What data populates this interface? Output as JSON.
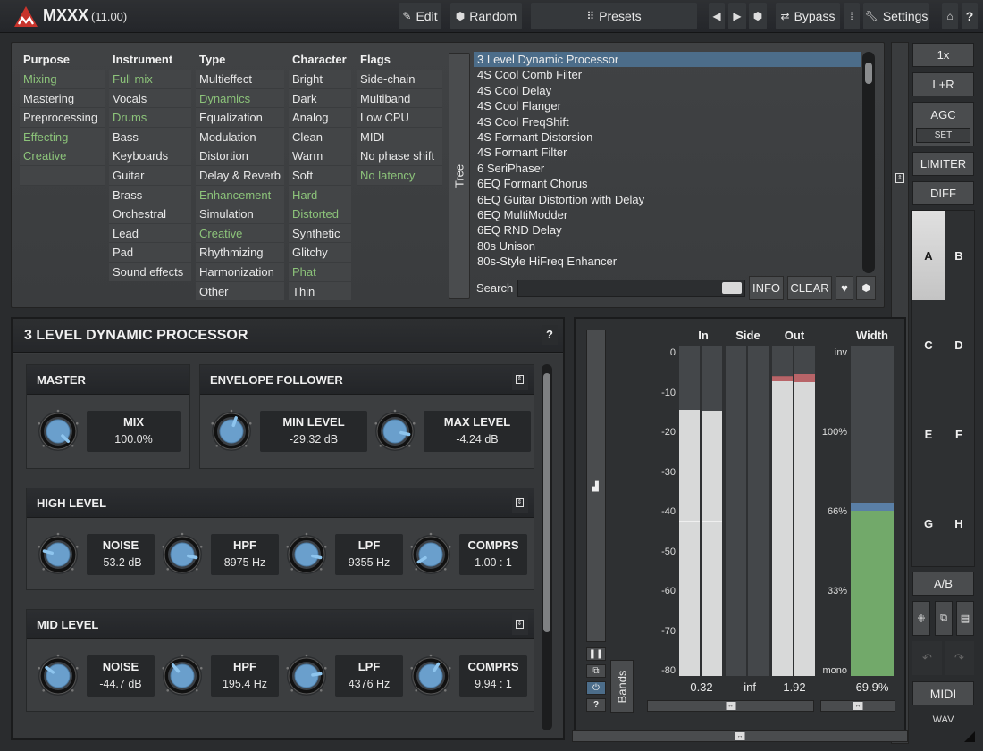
{
  "app": {
    "title": "MXXX",
    "version": "(11.00)"
  },
  "toolbar": {
    "edit": "Edit",
    "random": "Random",
    "presets": "Presets",
    "bypass": "Bypass",
    "settings": "Settings",
    "help": "?"
  },
  "browser": {
    "columns": [
      {
        "header": "Purpose",
        "items": [
          {
            "label": "Mixing",
            "selected": true
          },
          {
            "label": "Mastering",
            "selected": false
          },
          {
            "label": "Preprocessing",
            "selected": false
          },
          {
            "label": "Effecting",
            "selected": true
          },
          {
            "label": "Creative",
            "selected": true
          },
          {
            "label": "",
            "selected": false
          }
        ]
      },
      {
        "header": "Instrument",
        "items": [
          {
            "label": "Full mix",
            "selected": true
          },
          {
            "label": "Vocals",
            "selected": false
          },
          {
            "label": "Drums",
            "selected": true
          },
          {
            "label": "Bass",
            "selected": false
          },
          {
            "label": "Keyboards",
            "selected": false
          },
          {
            "label": "Guitar",
            "selected": false
          },
          {
            "label": "Brass",
            "selected": false
          },
          {
            "label": "Orchestral",
            "selected": false
          },
          {
            "label": "Lead",
            "selected": false
          },
          {
            "label": "Pad",
            "selected": false
          },
          {
            "label": "Sound effects",
            "selected": false
          }
        ]
      },
      {
        "header": "Type",
        "items": [
          {
            "label": "Multieffect",
            "selected": false
          },
          {
            "label": "Dynamics",
            "selected": true
          },
          {
            "label": "Equalization",
            "selected": false
          },
          {
            "label": "Modulation",
            "selected": false
          },
          {
            "label": "Distortion",
            "selected": false
          },
          {
            "label": "Delay & Reverb",
            "selected": false
          },
          {
            "label": "Enhancement",
            "selected": true
          },
          {
            "label": "Simulation",
            "selected": false
          },
          {
            "label": "Creative",
            "selected": true
          },
          {
            "label": "Rhythmizing",
            "selected": false
          },
          {
            "label": "Harmonization",
            "selected": false
          },
          {
            "label": "Other",
            "selected": false
          }
        ]
      },
      {
        "header": "Character",
        "items": [
          {
            "label": "Bright",
            "selected": false
          },
          {
            "label": "Dark",
            "selected": false
          },
          {
            "label": "Analog",
            "selected": false
          },
          {
            "label": "Clean",
            "selected": false
          },
          {
            "label": "Warm",
            "selected": false
          },
          {
            "label": "Soft",
            "selected": false
          },
          {
            "label": "Hard",
            "selected": true
          },
          {
            "label": "Distorted",
            "selected": true
          },
          {
            "label": "Synthetic",
            "selected": false
          },
          {
            "label": "Glitchy",
            "selected": false
          },
          {
            "label": "Phat",
            "selected": true
          },
          {
            "label": "Thin",
            "selected": false
          }
        ]
      },
      {
        "header": "Flags",
        "items": [
          {
            "label": "Side-chain",
            "selected": false
          },
          {
            "label": "Multiband",
            "selected": false
          },
          {
            "label": "Low CPU",
            "selected": false
          },
          {
            "label": "MIDI",
            "selected": false
          },
          {
            "label": "No phase shift",
            "selected": false
          },
          {
            "label": "No latency",
            "selected": true
          }
        ]
      }
    ],
    "tree_label": "Tree",
    "presets": [
      "3 Level Dynamic Processor",
      "4S Cool Comb Filter",
      "4S Cool Delay",
      "4S Cool Flanger",
      "4S Cool FreqShift",
      "4S Formant Distorsion",
      "4S Formant Filter",
      "6 SeriPhaser",
      "6EQ Formant Chorus",
      "6EQ Guitar Distortion with Delay",
      "6EQ MultiModder",
      "6EQ RND Delay",
      "80s Unison",
      "80s-Style HiFreq Enhancer"
    ],
    "selected_preset_index": 0,
    "search_label": "Search",
    "search_value": "",
    "info": "INFO",
    "clear": "CLEAR"
  },
  "right_panel": {
    "oversampling": "1x",
    "channel": "L+R",
    "agc": "AGC",
    "agc_set": "SET",
    "limiter": "LIMITER",
    "diff": "DIFF",
    "slots": [
      "A",
      "B",
      "C",
      "D",
      "E",
      "F",
      "G",
      "H"
    ],
    "active_slot": "A",
    "ab": "A/B",
    "midi": "MIDI",
    "wav": "WAV"
  },
  "editor": {
    "title": "3 LEVEL DYNAMIC PROCESSOR",
    "help": "?",
    "groups": {
      "master": {
        "title": "MASTER",
        "params": [
          {
            "name": "MIX",
            "value": "100.0%",
            "norm": 1.0
          }
        ]
      },
      "envelope": {
        "title": "ENVELOPE FOLLOWER",
        "params": [
          {
            "name": "MIN LEVEL",
            "value": "-29.32 dB",
            "norm": 0.57
          },
          {
            "name": "MAX LEVEL",
            "value": "-4.24 dB",
            "norm": 0.88
          }
        ]
      },
      "high": {
        "title": "HIGH LEVEL",
        "params": [
          {
            "name": "NOISE",
            "value": "-53.2 dB",
            "norm": 0.22
          },
          {
            "name": "HPF",
            "value": "8975 Hz",
            "norm": 0.88
          },
          {
            "name": "LPF",
            "value": "9355 Hz",
            "norm": 0.88
          },
          {
            "name": "COMPRS",
            "value": "1.00 : 1",
            "norm": 0.05
          }
        ]
      },
      "mid": {
        "title": "MID LEVEL",
        "params": [
          {
            "name": "NOISE",
            "value": "-44.7 dB",
            "norm": 0.3
          },
          {
            "name": "HPF",
            "value": "195.4 Hz",
            "norm": 0.35
          },
          {
            "name": "LPF",
            "value": "4376 Hz",
            "norm": 0.8
          },
          {
            "name": "COMPRS",
            "value": "9.94 : 1",
            "norm": 0.62
          }
        ]
      }
    }
  },
  "meters": {
    "headers": {
      "in": "In",
      "side": "Side",
      "out": "Out",
      "width": "Width"
    },
    "db_ticks": [
      "0",
      "-10",
      "-20",
      "-30",
      "-40",
      "-50",
      "-60",
      "-70",
      "-80"
    ],
    "width_ticks": [
      "inv",
      "100%",
      "66%",
      "33%",
      "mono"
    ],
    "readouts": {
      "in": "0.32",
      "side": "-inf",
      "out": "1.92",
      "width": "69.9%"
    },
    "levels_db": {
      "in_l": -15.5,
      "in_r": -15.8,
      "in_hold": -42.5,
      "side_l": -80,
      "side_r": -80,
      "out_l": -8.7,
      "out_r": -8.8,
      "out_peak_l": -8.3,
      "out_peak_r": -7.6,
      "out_hold_l": -7.5
    },
    "width_fill": 0.5,
    "width_marker": 0.52,
    "width_hold": 0.82,
    "bands_label": "Bands"
  }
}
